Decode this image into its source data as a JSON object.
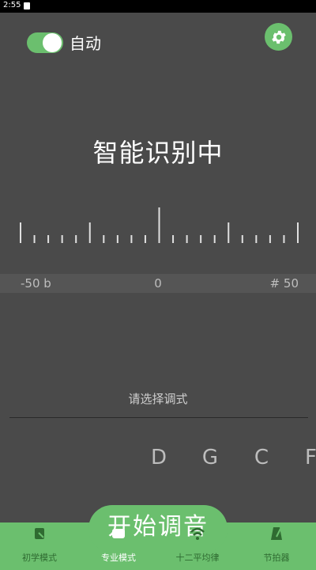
{
  "status_bar": {
    "time": "2:55"
  },
  "auto": {
    "label": "自动",
    "enabled": true
  },
  "detect_status": "智能识别中",
  "scale": {
    "min_label": "-50 b",
    "center_label": "0",
    "max_label": "# 50"
  },
  "tuning_hint": "请选择调式",
  "notes": [
    {
      "label": "D",
      "active": true
    },
    {
      "label": "G",
      "active": false
    },
    {
      "label": "C",
      "active": false
    },
    {
      "label": "F",
      "active": false
    }
  ],
  "start_button": {
    "label": "开始调音"
  },
  "nav": [
    {
      "label": "初学模式",
      "icon": "beginner-icon",
      "active": false
    },
    {
      "label": "专业模式",
      "icon": "pro-icon",
      "active": true
    },
    {
      "label": "十二平均律",
      "icon": "wave-icon",
      "active": false
    },
    {
      "label": "节拍器",
      "icon": "metronome-icon",
      "active": false
    }
  ],
  "colors": {
    "accent": "#6bbf6e",
    "background": "#4a4a4a"
  }
}
